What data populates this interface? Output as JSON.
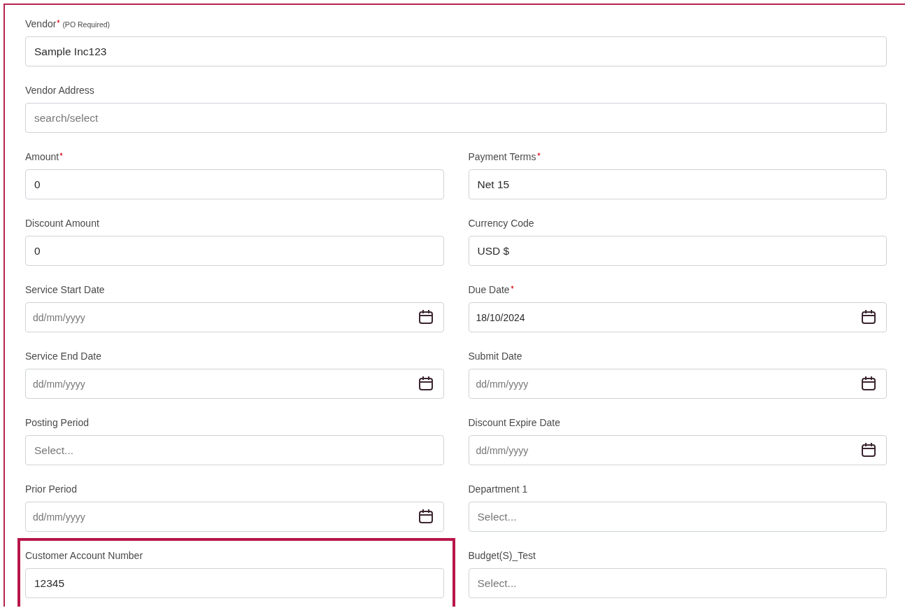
{
  "wide_fields": [
    {
      "label": "Vendor",
      "required": true,
      "note": "(PO Required)",
      "kind": "text",
      "value": "Sample Inc123"
    },
    {
      "label": "Vendor Address",
      "required": false,
      "kind": "text",
      "placeholder": "search/select"
    }
  ],
  "fields": [
    {
      "label": "Amount",
      "required": true,
      "kind": "text",
      "value": "0"
    },
    {
      "label": "Payment Terms",
      "required": true,
      "kind": "text",
      "value": "Net 15"
    },
    {
      "label": "Discount Amount",
      "required": false,
      "kind": "text",
      "value": "0"
    },
    {
      "label": "Currency Code",
      "required": false,
      "kind": "text",
      "value": "USD $"
    },
    {
      "label": "Service Start Date",
      "required": false,
      "kind": "date",
      "placeholder": "dd/mm/yyyy"
    },
    {
      "label": "Due Date",
      "required": true,
      "kind": "date",
      "value": "18/10/2024"
    },
    {
      "label": "Service End Date",
      "required": false,
      "kind": "date",
      "placeholder": "dd/mm/yyyy"
    },
    {
      "label": "Submit Date",
      "required": false,
      "kind": "date",
      "placeholder": "dd/mm/yyyy"
    },
    {
      "label": "Posting Period",
      "required": false,
      "kind": "text",
      "placeholder": "Select..."
    },
    {
      "label": "Discount Expire Date",
      "required": false,
      "kind": "date",
      "placeholder": "dd/mm/yyyy"
    },
    {
      "label": "Prior Period",
      "required": false,
      "kind": "date",
      "placeholder": "dd/mm/yyyy"
    },
    {
      "label": "Department 1",
      "required": false,
      "kind": "text",
      "placeholder": "Select..."
    },
    {
      "label": "Customer Account Number",
      "required": false,
      "highlighted": true,
      "kind": "text",
      "value": "12345"
    },
    {
      "label": "Budget(S)_Test",
      "required": false,
      "kind": "text",
      "placeholder": "Select..."
    }
  ]
}
